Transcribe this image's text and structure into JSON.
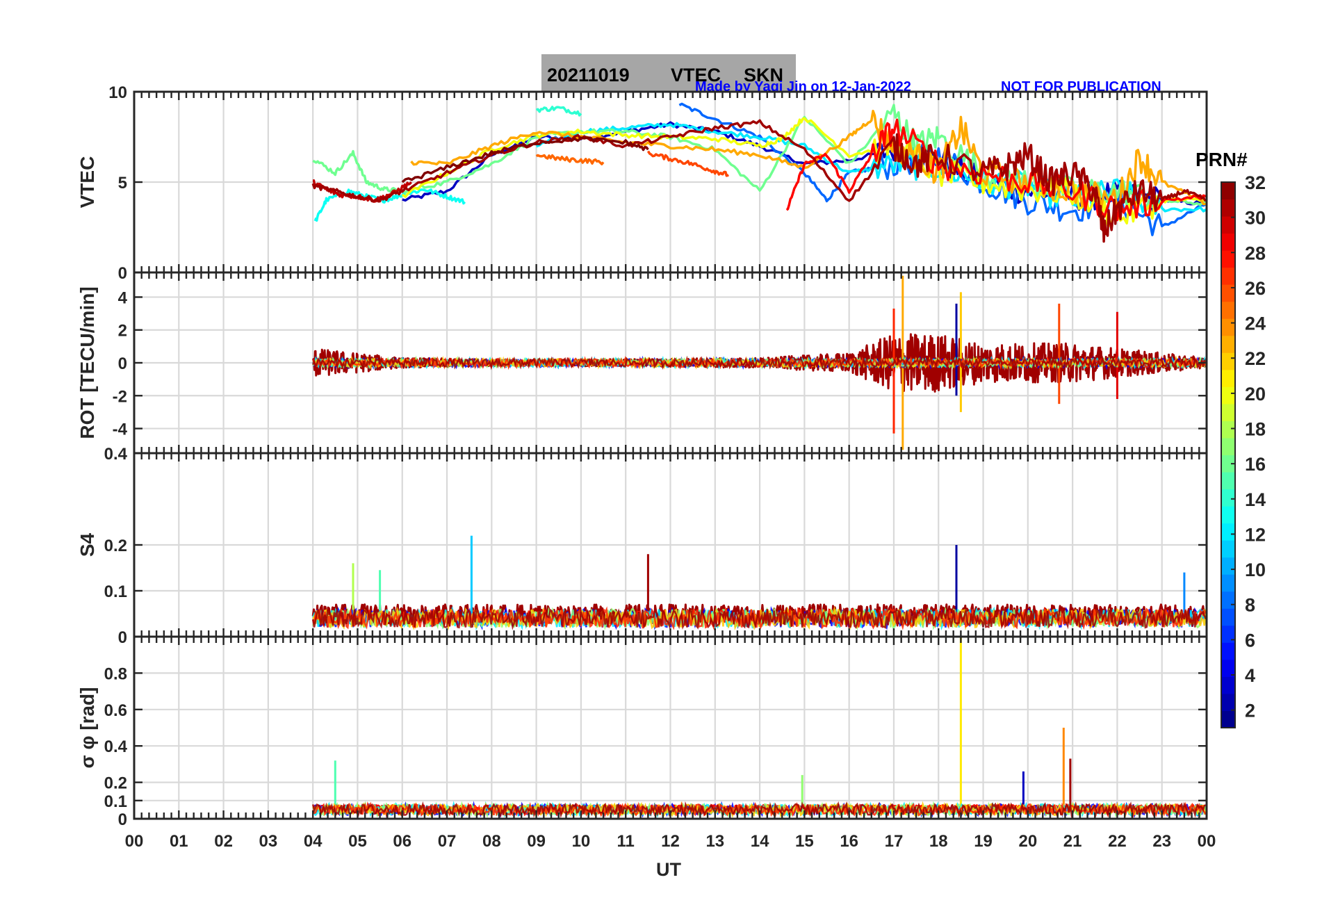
{
  "title": {
    "date": "20211019",
    "quantity": "VTEC",
    "station": "SKN"
  },
  "credit": "Made by Yaqi Jin on 12-Jan-2022",
  "notice": "NOT FOR PUBLICATION",
  "colors": {
    "title_box": "#a6a6a6",
    "credit_text": "#0000ff",
    "grid": "#d9d9d9",
    "axes": "#262626"
  },
  "colorbar": {
    "label": "PRN#",
    "range": [
      1,
      32
    ],
    "colormap": "jet",
    "ticks": [
      "2",
      "4",
      "6",
      "8",
      "10",
      "12",
      "14",
      "16",
      "18",
      "20",
      "22",
      "24",
      "26",
      "28",
      "30",
      "32"
    ]
  },
  "chart_data": [
    {
      "type": "line",
      "panel": "vtec",
      "ylabel": "VTEC",
      "ylim": [
        0,
        10
      ],
      "yticks": [
        "0",
        "5",
        "10"
      ],
      "grid": true,
      "series": [
        {
          "prn": 3,
          "x": [
            6.0,
            7.0,
            8.0,
            9.0,
            10.0,
            11.0,
            12.0,
            13.0,
            14.0,
            15.0,
            16.0,
            17.0,
            18.0,
            19.0,
            20.0,
            21.0,
            22.0,
            23.0,
            24.0
          ],
          "y": [
            4.0,
            4.5,
            6.5,
            7.5,
            7.4,
            7.8,
            8.2,
            7.8,
            7.0,
            6.0,
            6.2,
            6.8,
            6.2,
            5.0,
            4.5,
            4.2,
            4.3,
            4.0,
            3.8
          ]
        },
        {
          "prn": 8,
          "x": [
            12.2,
            13.0,
            14.0,
            15.0,
            15.5,
            16.0,
            17.0,
            18.0,
            19.0,
            20.0,
            21.0,
            22.0,
            23.0,
            24.0
          ],
          "y": [
            9.3,
            8.5,
            7.5,
            5.5,
            4.0,
            5.5,
            6.0,
            6.5,
            5.0,
            4.0,
            3.5,
            4.0,
            2.5,
            3.8
          ]
        },
        {
          "prn": 12,
          "x": [
            9.0,
            10.0,
            11.0,
            12.0,
            13.0,
            14.0,
            15.0,
            16.0,
            17.0,
            18.0,
            19.0,
            20.0,
            21.0,
            22.0,
            23.0,
            24.0
          ],
          "y": [
            7.0,
            7.8,
            8.0,
            8.2,
            7.8,
            7.5,
            7.0,
            5.5,
            6.0,
            5.8,
            5.0,
            4.8,
            4.0,
            4.5,
            3.5,
            3.5
          ]
        },
        {
          "prn": 13,
          "x": [
            4.05,
            4.3,
            4.8,
            5.2,
            5.6,
            6.0,
            6.5,
            7.0,
            7.4
          ],
          "y": [
            2.8,
            4.0,
            4.5,
            4.2,
            4.0,
            4.3,
            4.6,
            4.2,
            3.9
          ]
        },
        {
          "prn": 14,
          "x": [
            9.0,
            9.5,
            10.0
          ],
          "y": [
            9.0,
            9.1,
            8.8
          ]
        },
        {
          "prn": 16,
          "x": [
            4.0,
            4.5,
            4.9,
            5.2,
            5.6,
            6.0,
            7.0,
            8.0,
            9.0,
            10.0,
            11.0,
            12.0,
            13.0,
            14.0,
            15.0,
            16.0,
            17.0,
            17.5,
            18.0,
            19.0,
            20.0,
            21.0,
            22.0,
            23.0,
            24.0
          ],
          "y": [
            6.3,
            5.5,
            6.6,
            5.0,
            4.6,
            4.5,
            5.0,
            6.0,
            7.5,
            7.8,
            7.8,
            7.5,
            6.8,
            4.5,
            8.6,
            6.0,
            8.8,
            7.0,
            7.5,
            5.5,
            5.0,
            4.5,
            4.5,
            4.0,
            3.8
          ]
        },
        {
          "prn": 20,
          "x": [
            6.0,
            7.0,
            8.0,
            9.0,
            10.0,
            11.0,
            12.0,
            13.0,
            14.0,
            14.5,
            15.0,
            16.0,
            17.0,
            18.0,
            19.0,
            20.0,
            21.0,
            22.0,
            23.0,
            24.0
          ],
          "y": [
            4.2,
            5.5,
            6.8,
            7.6,
            7.8,
            7.6,
            7.5,
            7.4,
            7.0,
            7.4,
            8.6,
            6.5,
            7.0,
            5.5,
            5.0,
            4.6,
            4.4,
            3.0,
            4.0,
            4.0
          ]
        },
        {
          "prn": 23,
          "x": [
            6.2,
            7.0,
            8.0,
            9.0,
            10.0,
            11.0,
            12.0,
            13.0,
            14.0,
            15.0,
            16.0,
            16.5,
            17.0,
            17.5,
            18.0,
            18.5,
            19.0,
            20.0,
            21.0,
            22.0,
            22.5,
            23.0,
            24.0
          ],
          "y": [
            6.1,
            6.0,
            7.0,
            7.8,
            7.5,
            7.2,
            7.0,
            6.8,
            6.5,
            5.8,
            7.5,
            8.5,
            7.0,
            6.5,
            5.5,
            8.0,
            5.5,
            5.0,
            4.5,
            4.0,
            6.4,
            5.0,
            3.8
          ]
        },
        {
          "prn": 25,
          "x": [
            9.0,
            9.5,
            10.0,
            10.5
          ],
          "y": [
            6.5,
            6.3,
            6.2,
            6.1
          ]
        },
        {
          "prn": 26,
          "x": [
            11.5,
            12.0,
            12.5,
            13.0,
            13.3
          ],
          "y": [
            6.6,
            6.3,
            6.0,
            5.6,
            5.4
          ]
        },
        {
          "prn": 28,
          "x": [
            14.6,
            15.0,
            15.5,
            16.0,
            16.5,
            17.0,
            18.0,
            19.0,
            20.0,
            21.0,
            22.0,
            23.0,
            24.0
          ],
          "y": [
            3.4,
            6.0,
            6.5,
            4.5,
            6.5,
            8.0,
            6.0,
            5.5,
            5.0,
            4.5,
            3.5,
            4.0,
            4.2
          ]
        },
        {
          "prn": 30,
          "x": [
            4.0,
            4.3,
            4.6,
            5.0,
            5.4,
            5.8,
            6.2
          ],
          "y": [
            5.0,
            4.6,
            4.3,
            4.2,
            4.0,
            4.4,
            5.0
          ]
        },
        {
          "prn": 31,
          "x": [
            4.0,
            4.5,
            5.0,
            5.5,
            6.0,
            7.0,
            8.0,
            9.0,
            10.0,
            11.0,
            12.0,
            13.0,
            14.0,
            15.0,
            16.0,
            17.0,
            17.5,
            18.0,
            19.0,
            19.5,
            20.0,
            20.5,
            21.0,
            21.5,
            21.7,
            22.0,
            22.5,
            23.0,
            23.5,
            24.0
          ],
          "y": [
            4.8,
            4.5,
            4.2,
            4.0,
            4.5,
            5.5,
            6.5,
            7.2,
            7.5,
            7.0,
            7.5,
            8.0,
            8.3,
            6.8,
            4.0,
            7.0,
            6.0,
            6.5,
            5.5,
            5.8,
            6.5,
            5.0,
            5.5,
            4.5,
            2.2,
            3.5,
            4.5,
            4.0,
            4.5,
            4.0
          ]
        },
        {
          "prn": 32,
          "x": [
            6.0,
            7.0,
            8.0,
            9.0,
            10.0,
            11.0,
            11.5
          ],
          "y": [
            5.0,
            5.8,
            6.6,
            7.2,
            7.4,
            7.2,
            6.8
          ]
        }
      ]
    },
    {
      "type": "line",
      "panel": "rot",
      "ylabel": "ROT [TECU/min]",
      "ylim": [
        -5.5,
        5.5
      ],
      "yticks": [
        "-4",
        "-2",
        "0",
        "2",
        "4"
      ],
      "grid": true,
      "series": [
        {
          "prn": 31,
          "x": [
            4.0,
            24.0
          ],
          "y": [
            0.0,
            0.0
          ],
          "envelope": [
            [
              4.0,
              1.5
            ],
            [
              5.0,
              1.0
            ],
            [
              6.0,
              0.5
            ],
            [
              9.0,
              0.3
            ],
            [
              14.0,
              0.5
            ],
            [
              16.0,
              1.0
            ],
            [
              17.0,
              3.0
            ],
            [
              18.0,
              3.0
            ],
            [
              19.0,
              2.0
            ],
            [
              21.0,
              2.0
            ],
            [
              23.0,
              1.0
            ],
            [
              24.0,
              0.5
            ]
          ]
        },
        {
          "prn": 23,
          "x": [
            17.2,
            17.2
          ],
          "y": [
            -5.3,
            5.3
          ]
        },
        {
          "prn": 22,
          "x": [
            18.5,
            18.5
          ],
          "y": [
            -3.0,
            4.3
          ]
        },
        {
          "prn": 27,
          "x": [
            17.0,
            17.0
          ],
          "y": [
            -4.3,
            3.3
          ]
        },
        {
          "prn": 2,
          "x": [
            18.4,
            18.4
          ],
          "y": [
            -2.0,
            3.6
          ]
        },
        {
          "prn": 26,
          "x": [
            20.7,
            20.7
          ],
          "y": [
            -2.5,
            3.6
          ]
        },
        {
          "prn": 29,
          "x": [
            22.0,
            22.0
          ],
          "y": [
            -2.2,
            3.1
          ]
        }
      ]
    },
    {
      "type": "line",
      "panel": "s4",
      "ylabel": "S4",
      "ylim": [
        0,
        0.4
      ],
      "yticks": [
        "0",
        "0.1",
        "0.2",
        "0.4"
      ],
      "grid": true,
      "series": [
        {
          "prn": 31,
          "x": [
            4.0,
            24.0
          ],
          "y": [
            0.045,
            0.045
          ],
          "noise_max": 0.08
        },
        {
          "prn": 11,
          "x": [
            7.55,
            7.55
          ],
          "y": [
            0.04,
            0.22
          ]
        },
        {
          "prn": 31,
          "x": [
            11.5,
            11.5
          ],
          "y": [
            0.04,
            0.18
          ]
        },
        {
          "prn": 2,
          "x": [
            18.4,
            18.4
          ],
          "y": [
            0.04,
            0.2
          ]
        },
        {
          "prn": 18,
          "x": [
            4.9,
            4.9
          ],
          "y": [
            0.04,
            0.16
          ]
        },
        {
          "prn": 15,
          "x": [
            5.5,
            5.5
          ],
          "y": [
            0.04,
            0.145
          ]
        },
        {
          "prn": 9,
          "x": [
            23.5,
            23.5
          ],
          "y": [
            0.04,
            0.14
          ]
        }
      ]
    },
    {
      "type": "line",
      "panel": "sigma_phi",
      "ylabel": "σ φ [rad]",
      "ylim": [
        0,
        1.0
      ],
      "yticks": [
        "0",
        "0.1",
        "0.2",
        "0.4",
        "0.6",
        "0.8"
      ],
      "grid": true,
      "series": [
        {
          "prn": 28,
          "x": [
            4.0,
            24.0
          ],
          "y": [
            0.06,
            0.06
          ],
          "noise_max": 0.08
        },
        {
          "prn": 15,
          "x": [
            4.5,
            4.5
          ],
          "y": [
            0.05,
            0.32
          ]
        },
        {
          "prn": 21,
          "x": [
            18.5,
            18.5
          ],
          "y": [
            0.03,
            1.0
          ]
        },
        {
          "prn": 24,
          "x": [
            20.8,
            20.8
          ],
          "y": [
            0.04,
            0.5
          ]
        },
        {
          "prn": 31,
          "x": [
            20.95,
            20.95
          ],
          "y": [
            0.04,
            0.33
          ]
        },
        {
          "prn": 3,
          "x": [
            19.9,
            19.9
          ],
          "y": [
            0.04,
            0.26
          ]
        },
        {
          "prn": 17,
          "x": [
            14.95,
            14.95
          ],
          "y": [
            0.04,
            0.24
          ]
        }
      ]
    }
  ],
  "xaxis": {
    "label": "UT",
    "range": [
      0,
      24
    ],
    "ticks": [
      "00",
      "01",
      "02",
      "03",
      "04",
      "05",
      "06",
      "07",
      "08",
      "09",
      "10",
      "11",
      "12",
      "13",
      "14",
      "15",
      "16",
      "17",
      "18",
      "19",
      "20",
      "21",
      "22",
      "23",
      "00"
    ]
  }
}
